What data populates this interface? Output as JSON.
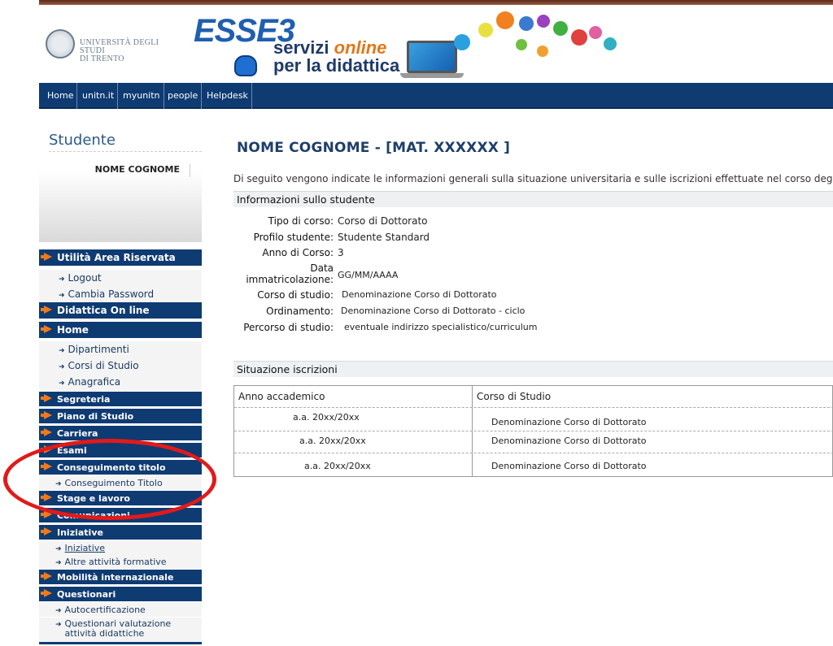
{
  "header": {
    "university_name": [
      "UNIVERSITÀ DEGLI STUDI",
      "DI TRENTO"
    ],
    "brand": "ESSE3",
    "tagline_line1": "servizi",
    "tagline_online": "online",
    "tagline_line2": "per la didattica"
  },
  "nav": {
    "items": [
      "Home",
      "unitn.it",
      "myunitn",
      "people",
      "Helpdesk"
    ]
  },
  "sidebar": {
    "title": "Studente",
    "user_name": "NOME COGNOME",
    "menu": [
      {
        "label": "Utilità Area Riservata",
        "type": "bar"
      },
      {
        "label": "Logout",
        "type": "sub"
      },
      {
        "label": "Cambia Password",
        "type": "sub"
      },
      {
        "label": "Didattica On line",
        "type": "bar"
      },
      {
        "label": "Home",
        "type": "bar"
      },
      {
        "label": "Dipartimenti",
        "type": "sub"
      },
      {
        "label": "Corsi di Studio",
        "type": "sub"
      },
      {
        "label": "Anagrafica",
        "type": "sub"
      },
      {
        "label": "Segreteria",
        "type": "bar"
      },
      {
        "label": "Piano di Studio",
        "type": "bar"
      },
      {
        "label": "Carriera",
        "type": "bar"
      },
      {
        "label": "Esami",
        "type": "bar"
      },
      {
        "label": "Conseguimento titolo",
        "type": "bar"
      },
      {
        "label": "Conseguimento Titolo",
        "type": "sub"
      },
      {
        "label": "Stage e lavoro",
        "type": "bar"
      },
      {
        "label": "Comunicazioni",
        "type": "bar"
      },
      {
        "label": "Iniziative",
        "type": "bar"
      },
      {
        "label": "Iniziative",
        "type": "sub"
      },
      {
        "label": "Altre attività formative",
        "type": "sub"
      },
      {
        "label": "Mobilità internazionale",
        "type": "bar"
      },
      {
        "label": "Questionari",
        "type": "bar"
      },
      {
        "label": "Autocertificazione",
        "type": "sub"
      },
      {
        "label": "Questionari valutazione attività didattiche",
        "type": "sub"
      }
    ]
  },
  "main": {
    "title": "NOME COGNOME - [MAT. XXXXXX ]",
    "intro": "Di seguito vengono indicate le informazioni generali sulla situazione universitaria e sulle iscrizioni effettuate nel corso degli anni.",
    "info_section_title": "Informazioni sullo studente",
    "info": [
      {
        "label": "Tipo di corso:",
        "value": "Corso di Dottorato"
      },
      {
        "label": "Profilo studente:",
        "value": "Studente Standard"
      },
      {
        "label": "Anno di Corso:",
        "value": "3"
      },
      {
        "label": "Data immatricolazione:",
        "value": "GG/MM/AAAA"
      },
      {
        "label": "Corso di studio:",
        "value": "Denominazione Corso di Dottorato"
      },
      {
        "label": "Ordinamento:",
        "value": "Denominazione Corso di Dottorato - ciclo"
      },
      {
        "label": "Percorso di studio:",
        "value": "eventuale indirizzo specialistico/curriculum"
      }
    ],
    "enrollment_section_title": "Situazione iscrizioni",
    "table": {
      "headers": [
        "Anno accademico",
        "Corso di Studio"
      ],
      "rows": [
        [
          "a.a. 20xx/20xx",
          "Denominazione Corso di Dottorato"
        ],
        [
          "a.a. 20xx/20xx",
          "Denominazione Corso di Dottorato"
        ],
        [
          "a.a. 20xx/20xx",
          "Denominazione Corso di Dottorato"
        ]
      ]
    }
  },
  "colors": {
    "nav_bg": "#0f3b73",
    "accent_arrow": "#f07a1a",
    "annotation": "#e21a1a"
  }
}
